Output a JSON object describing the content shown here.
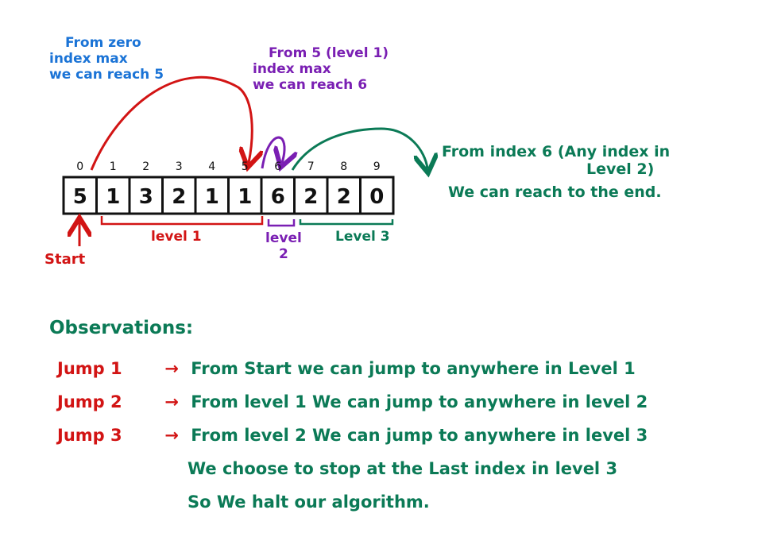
{
  "colors": {
    "blue": "#1a73d6",
    "purple": "#7a1fb3",
    "green": "#0b7a56",
    "red": "#d21414",
    "ink": "#111111"
  },
  "array": {
    "indices": [
      "0",
      "1",
      "2",
      "3",
      "4",
      "5",
      "6",
      "7",
      "8",
      "9"
    ],
    "values": [
      "5",
      "1",
      "3",
      "2",
      "1",
      "1",
      "6",
      "2",
      "2",
      "0"
    ]
  },
  "notes": {
    "from_zero": [
      "From zero",
      "index max",
      "we can reach 5"
    ],
    "from_five": [
      "From 5 (level 1)",
      "index max",
      "we can reach 6"
    ],
    "from_six": [
      "From index 6 (Any index in",
      "Level 2)",
      "We can reach to the end."
    ]
  },
  "labels": {
    "start": "Start",
    "level1": "level 1",
    "level2_a": "level",
    "level2_b": "2",
    "level3": "Level 3"
  },
  "observations": {
    "heading": "Observations:",
    "lines": [
      {
        "jump": "Jump 1",
        "arrow": "→",
        "text": "From Start we can jump to anywhere in Level 1"
      },
      {
        "jump": "Jump 2",
        "arrow": "→",
        "text": "From level 1 We can jump to anywhere in level 2"
      },
      {
        "jump": "Jump 3",
        "arrow": "→",
        "text": "From level 2 We can jump to anywhere in level 3"
      }
    ],
    "continuation": [
      "We choose to stop at the Last index in level 3",
      "So We halt our algorithm."
    ]
  }
}
